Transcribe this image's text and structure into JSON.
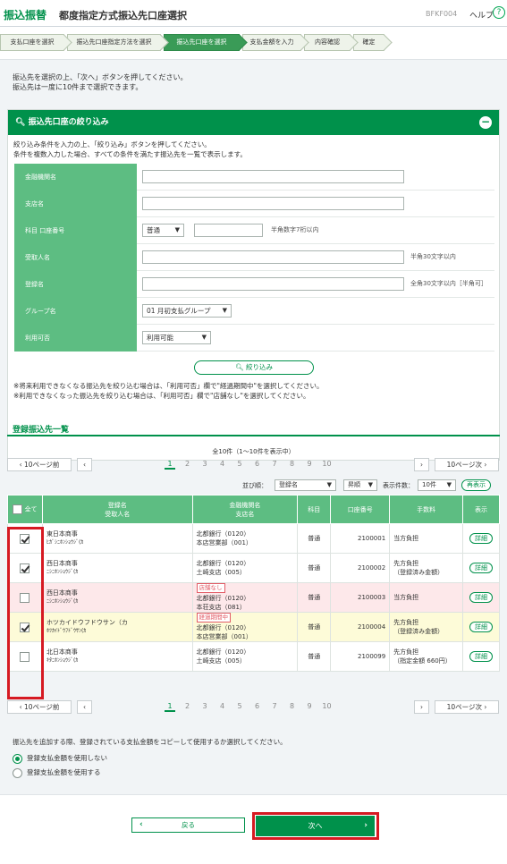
{
  "header": {
    "service": "振込振替",
    "screen_title": "都度指定方式振込先口座選択",
    "screen_code": "BFKF004",
    "help_label": "ヘルプ",
    "help_icon": "?"
  },
  "steps": [
    "支払口座を選択",
    "振込先口座指定方法を選択",
    "振込先口座を選択",
    "支払金額を入力",
    "内容確認",
    "確定"
  ],
  "current_step": 2,
  "intro": [
    "振込先を選択の上、「次へ」ボタンを押してください。",
    "振込先は一度に10件まで選択できます。"
  ],
  "filter": {
    "title": "振込先口座の絞り込み",
    "collapse_icon": "−",
    "desc": [
      "絞り込み条件を入力の上、「絞り込み」ボタンを押してください。",
      "条件を複数入力した場合、すべての条件を満たす振込先を一覧で表示します。"
    ],
    "labels": {
      "bank": "金融機関名",
      "branch": "支店名",
      "account": "科目 口座番号",
      "payee": "受取人名",
      "regname": "登録名",
      "group": "グループ名",
      "usable": "利用可否"
    },
    "account_type": "普通",
    "account_hint": "半角数字7桁以内",
    "payee_hint": "半角30文字以内",
    "regname_hint": "全角30文字以内［半角可］",
    "group_value": "01 月初支払グループ",
    "usable_value": "利用可能",
    "button": "絞り込み",
    "notes": [
      "※将来利用できなくなる振込先を絞り込む場合は、「利用可否」欄で\"経過期間中\"を選択してください。",
      "※利用できなくなった振込先を絞り込む場合は、「利用可否」欄で\"店舗なし\"を選択してください。"
    ]
  },
  "list": {
    "title": "登録振込先一覧",
    "count": "全10件（1〜10件を表示中）",
    "prev10": "10ページ前",
    "next10": "10ページ次",
    "pages": [
      "1",
      "2",
      "3",
      "4",
      "5",
      "6",
      "7",
      "8",
      "9",
      "10"
    ],
    "current_page": "1",
    "sort_label": "並び順：",
    "sort_value": "登録名",
    "order_value": "昇順",
    "per_page_label": "表示件数：",
    "per_page_value": "10件",
    "redisplay": "再表示",
    "columns": {
      "all": "全て",
      "name1": "登録名",
      "name2": "受取人名",
      "bank1": "金融機関名",
      "bank2": "支店名",
      "subject": "科目",
      "account": "口座番号",
      "fee": "手数料",
      "view": "表示"
    },
    "rows": [
      {
        "checked": true,
        "style": "",
        "name": "東日本商事",
        "kana": "ﾋｶﾞｼﾆﾎﾝｼｮｳｼﾞ(ｶ",
        "tag": "",
        "bank": "北都銀行（0120）",
        "branch": "本店営業部（001）",
        "subject": "普通",
        "account": "2100001",
        "fee1": "当方負担",
        "fee2": "",
        "detail": "詳細"
      },
      {
        "checked": true,
        "style": "",
        "name": "西日本商事",
        "kana": "ﾆｼﾆﾎﾝｼｮｳｼﾞ(ｶ",
        "tag": "",
        "bank": "北都銀行（0120）",
        "branch": "土崎支店（005）",
        "subject": "普通",
        "account": "2100002",
        "fee1": "先方負担",
        "fee2": "（登録済み金額）",
        "detail": "詳細"
      },
      {
        "checked": false,
        "style": "red",
        "name": "西日本商事",
        "kana": "ﾆｼﾆﾎﾝｼｮｳｼﾞ(ｶ",
        "tag": "店舗なし",
        "bank": "北都銀行（0120）",
        "branch": "本荘支店（081）",
        "subject": "普通",
        "account": "2100003",
        "fee1": "当方負担",
        "fee2": "",
        "detail": "詳細"
      },
      {
        "checked": true,
        "style": "yel",
        "name": "ホツカイドウフドウサン（カ",
        "kana": "ﾎﾂｶｲﾄﾞｳﾌﾄﾞｳｻﾝ(ｶ",
        "tag": "経過期間中",
        "bank": "北都銀行（0120）",
        "branch": "本店営業部（001）",
        "subject": "普通",
        "account": "2100004",
        "fee1": "先方負担",
        "fee2": "（登録済み金額）",
        "detail": "詳細"
      },
      {
        "checked": false,
        "style": "",
        "name": "北日本商事",
        "kana": "ｷﾀﾆﾎﾝｼｮｳｼﾞ(ｶ",
        "tag": "",
        "bank": "北都銀行（0120）",
        "branch": "土崎支店（005）",
        "subject": "普通",
        "account": "2100099",
        "fee1": "先方負担",
        "fee2": "（指定金額 660円）",
        "detail": "詳細"
      }
    ]
  },
  "copy_question": "振込先を追加する際、登録されている支払金額をコピーして使用するか選択してください。",
  "copy_options": [
    "登録支払金額を使用しない",
    "登録支払金額を使用する"
  ],
  "buttons": {
    "back": "戻る",
    "next": "次へ"
  },
  "colors": {
    "brand": "#00914b",
    "highlight": "#d61a22"
  }
}
